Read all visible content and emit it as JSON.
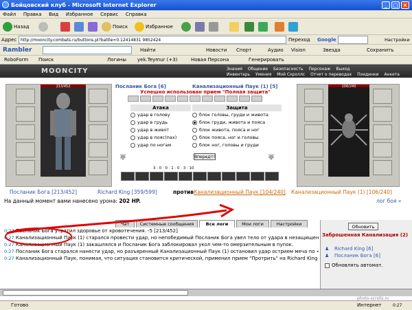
{
  "window": {
    "title": "Бойцовский клуб - Microsoft Internet Explorer"
  },
  "menu": [
    "Файл",
    "Правка",
    "Вид",
    "Избранное",
    "Сервис",
    "Справка"
  ],
  "toolbar": {
    "back": "Назад",
    "search": "Поиск",
    "favorites": "Избранное"
  },
  "address": {
    "label": "Адрес",
    "url": "http://mooncity.combats.ru/buttons.pl?battle=0.12414831 9852424",
    "go": "Переход",
    "google": "Google",
    "settings": "Настройки"
  },
  "rambler": {
    "logo": "Rambler",
    "find": "Найти",
    "news": "Новости",
    "sport": "Спорт",
    "audio": "Аудио",
    "vision": "Vision",
    "star": "Звезда",
    "save": "Сохранить"
  },
  "roboform": {
    "name": "RoboForm",
    "search": "Поиск",
    "logins": "Логины",
    "bookmark": "yek.Teymur (+3)",
    "new_search": "Новая Персона",
    "generate": "Генерировать"
  },
  "game": {
    "logo": "MOONCITY",
    "nav": [
      "Знания",
      "Общение",
      "Безопасность",
      "Персонаж",
      "Выход"
    ],
    "nav2": [
      "Инвентарь",
      "Умения",
      "Мой Скроллс",
      "Отчет о переводах",
      "Поединки",
      "Анкета"
    ],
    "left_hp": "213/452",
    "right_hp": "106/240",
    "fighter_left": "Посланик Бога [6]",
    "fighter_right": "Канализационный Паук (1) [5]",
    "success": "Успешно использован прием \"Полная защита\"",
    "attack_head": "Атака",
    "defense_head": "Защита",
    "attacks": [
      "удар в голову",
      "удар в грудь",
      "удар в живот",
      "удар в пояс(пах)",
      "удар по ногам"
    ],
    "defenses": [
      "блок головы, груди и живота",
      "блок груди, живота и пояса",
      "блок живота, пояса и ног",
      "блок пояса, ног и головы",
      "блок ног, головы и груди"
    ],
    "go_button": "Вперед!!!",
    "counters": "3 · 0 · 0 · 1 · 0 · 3 · 10",
    "fight_left": "Посланик Бога [213/452]",
    "fight_left_ally": "Richard King [359/599]",
    "versus": "против",
    "fight_right": "Канализационный Паук [104/240]",
    "fight_right2": "Канализационный Паук (1) [106/240]",
    "fight_more": "лог боя »",
    "damage_label": "На данный момент вами нанесено урона:",
    "damage_value": "202 HP."
  },
  "tabs": [
    "Чат",
    "Системные сообщения",
    "Все логи",
    "Мои логи",
    "Настройки"
  ],
  "log": [
    {
      "time": "0:27",
      "text": "Посланик Бога утратил здоровье от кровотечения. -5 [213/452]"
    },
    {
      "time": "0:27",
      "text": "Канализационный Паук (1) старался провести удар, но непобедимый Посланик Бога увел тело от удара в незащищенное ребро."
    },
    {
      "time": "0:27",
      "text": "Канализационный Паук (1) закашлялся и Посланик Бога заблокировал укол чем-то омерзительным в пупок."
    },
    {
      "time": "0:27",
      "text": "Посланик Бога старался нанести удар, но разъяренный Канализационный Паук (1) остановил удар острием меча по <вырезано цензурой>."
    },
    {
      "time": "0:27",
      "text": "Канализационный Паук, понимая, что ситуация становится критической, применил прием \"Протрить\" на Richard King -5 [359/599]"
    }
  ],
  "side": {
    "refresh": "Обновить",
    "location": "Заброшенная Канализация (2)",
    "player1": "Richard King [6]",
    "player2": "Посланик Бога [6]",
    "auto": "Обновлять автомат."
  },
  "status": {
    "done": "Готово",
    "zone": "Интернет",
    "clock": "0:27",
    "watermark": "photo-scrolls.ru"
  }
}
